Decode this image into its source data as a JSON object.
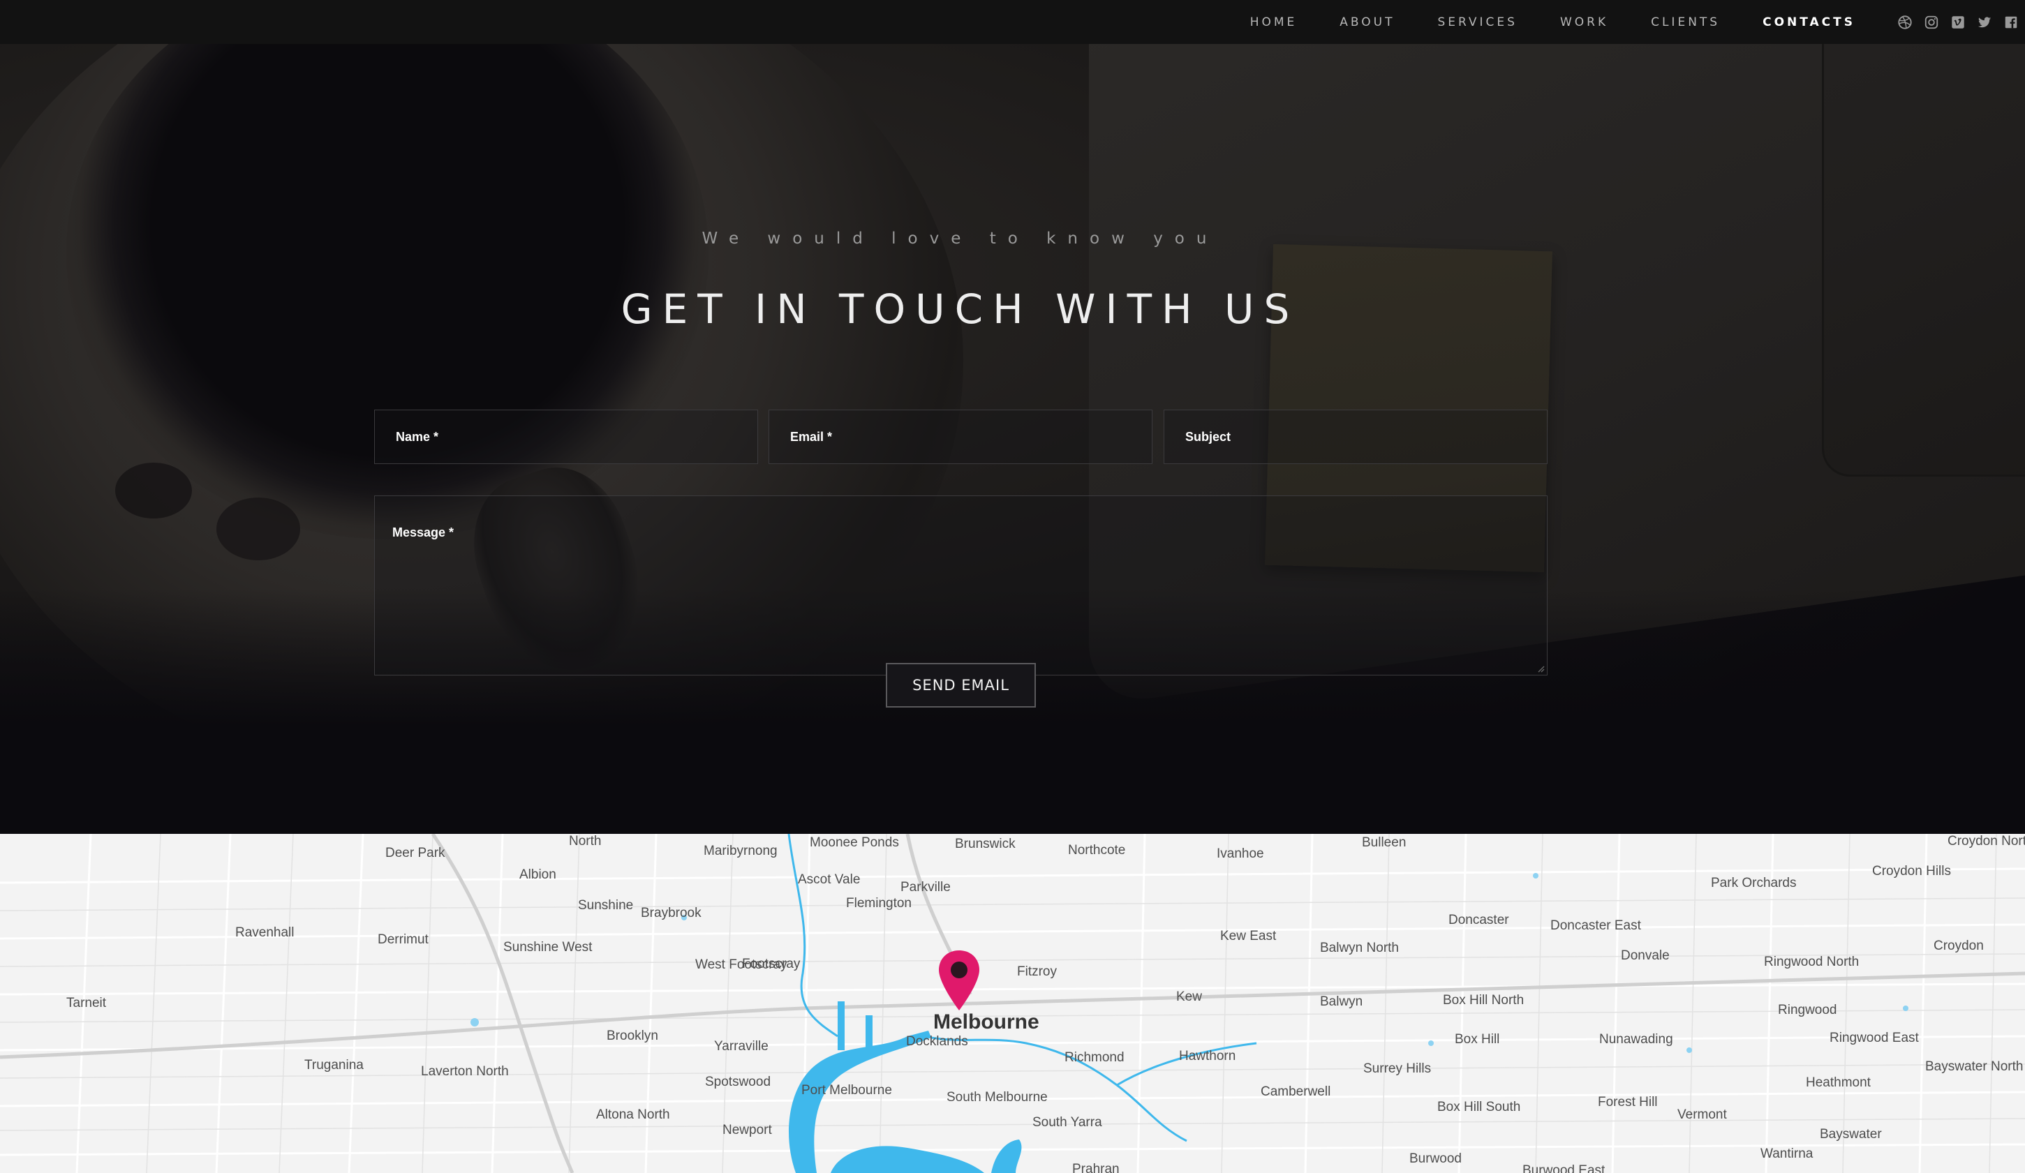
{
  "nav": {
    "links": [
      {
        "label": "HOME"
      },
      {
        "label": "ABOUT"
      },
      {
        "label": "SERVICES"
      },
      {
        "label": "WORK"
      },
      {
        "label": "CLIENTS"
      },
      {
        "label": "CONTACTS",
        "active": true
      }
    ],
    "social_icons": [
      "dribbble-icon",
      "instagram-icon",
      "vimeo-icon",
      "twitter-icon",
      "facebook-icon"
    ]
  },
  "hero": {
    "tagline": "We would love to know you",
    "heading": "GET IN TOUCH WITH US"
  },
  "form": {
    "name_placeholder": "Name *",
    "email_placeholder": "Email *",
    "subject_placeholder": "Subject",
    "message_placeholder": "Message *",
    "send_label": "SEND EMAIL"
  },
  "map": {
    "city": "Melbourne",
    "marker_color": "#e0196b",
    "water_color": "#3fb8ec",
    "labels": [
      "Deer Park",
      "North",
      "Maribyrnong",
      "Moonee Ponds",
      "Brunswick",
      "Northcote",
      "Ivanhoe",
      "Bulleen",
      "Croydon North",
      "Albion",
      "Ascot Vale",
      "Parkville",
      "Park Orchards",
      "Croydon Hills",
      "Ravenhall",
      "Sunshine",
      "Braybrook",
      "Flemington",
      "Doncaster",
      "Doncaster East",
      "Derrimut",
      "Sunshine West",
      "Kew East",
      "Balwyn North",
      "Donvale",
      "Ringwood North",
      "Croydon",
      "Tarneit",
      "West Footscray",
      "Footscray",
      "Fitzroy",
      "Kew",
      "Balwyn",
      "Box Hill North",
      "Ringwood",
      "Brooklyn",
      "Yarraville",
      "Docklands",
      "Richmond",
      "Hawthorn",
      "Box Hill",
      "Nunawading",
      "Ringwood East",
      "Truganina",
      "Laverton North",
      "Spotswood",
      "Port Melbourne",
      "South Melbourne",
      "Camberwell",
      "Surrey Hills",
      "Heathmont",
      "Bayswater North",
      "Box Hill South",
      "Forest Hill",
      "Vermont",
      "Altona North",
      "Newport",
      "South Yarra",
      "Bayswater",
      "Wantirna",
      "Burwood",
      "Burwood East",
      "Prahran"
    ]
  }
}
